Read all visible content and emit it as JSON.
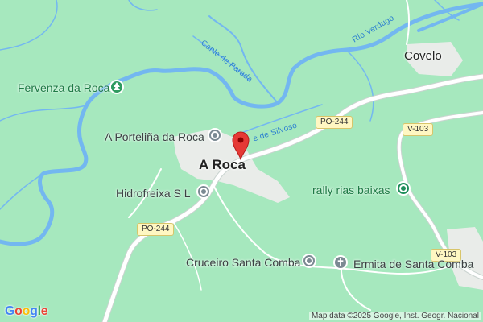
{
  "colors": {
    "land": "#a6e8be",
    "river": "#73b7f0",
    "road": "#ffffff",
    "road_outline": "#c9d3cf",
    "settlement": "#e9ece9",
    "marker": "#e53935"
  },
  "places": {
    "main_town": "A Roca",
    "covelo": "Covelo"
  },
  "pois": {
    "fervenza": "Fervenza da Roca",
    "portelina": "A Porteliña da Roca",
    "hidrofreixa": "Hidrofreixa S L",
    "rally": "rally rias baixas",
    "cruceiro": "Cruceiro Santa Comba",
    "ermita": "Ermita de Santa Comba"
  },
  "rivers": {
    "verdugo": "Río Verdugo",
    "parada": "Canle de Parada",
    "silvoso": "e de Silvoso"
  },
  "roads": {
    "po244_a": "PO-244",
    "po244_b": "PO-244",
    "v103_a": "V-103",
    "v103_b": "V-103"
  },
  "icons": {
    "marker": "location-pin-icon",
    "park": "tree-icon",
    "landmark": "landmark-icon",
    "church": "cross-icon"
  },
  "attribution": "Map data ©2025 Google, Inst. Geogr. Nacional",
  "logo": "Google"
}
